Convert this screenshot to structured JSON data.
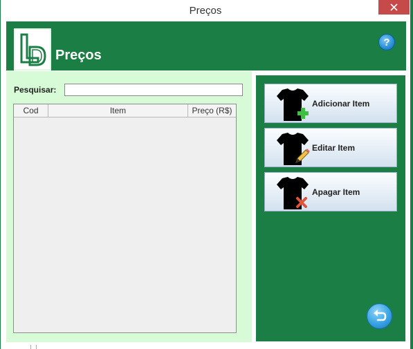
{
  "window": {
    "title": "Preços",
    "close_icon": "close-icon"
  },
  "header": {
    "logo_icon": "ld-logo-icon",
    "title": "Preços",
    "help_icon": "help-icon",
    "help_glyph": "?"
  },
  "search": {
    "label": "Pesquisar:",
    "value": "",
    "placeholder": ""
  },
  "table": {
    "columns": [
      "Cod",
      "Item",
      "Preço (R$)"
    ],
    "rows": []
  },
  "actions": [
    {
      "label": "Adicionar Item",
      "icon": "shirt-add-icon"
    },
    {
      "label": "Editar Item",
      "icon": "shirt-edit-icon"
    },
    {
      "label": "Apagar Item",
      "icon": "shirt-delete-icon"
    }
  ],
  "back": {
    "icon": "back-arrow-icon"
  },
  "colors": {
    "header_green": "#1b7f45",
    "panel_light_green": "#d6fbd6",
    "close_red": "#c74a4a",
    "help_blue": "#2a8fd6"
  }
}
